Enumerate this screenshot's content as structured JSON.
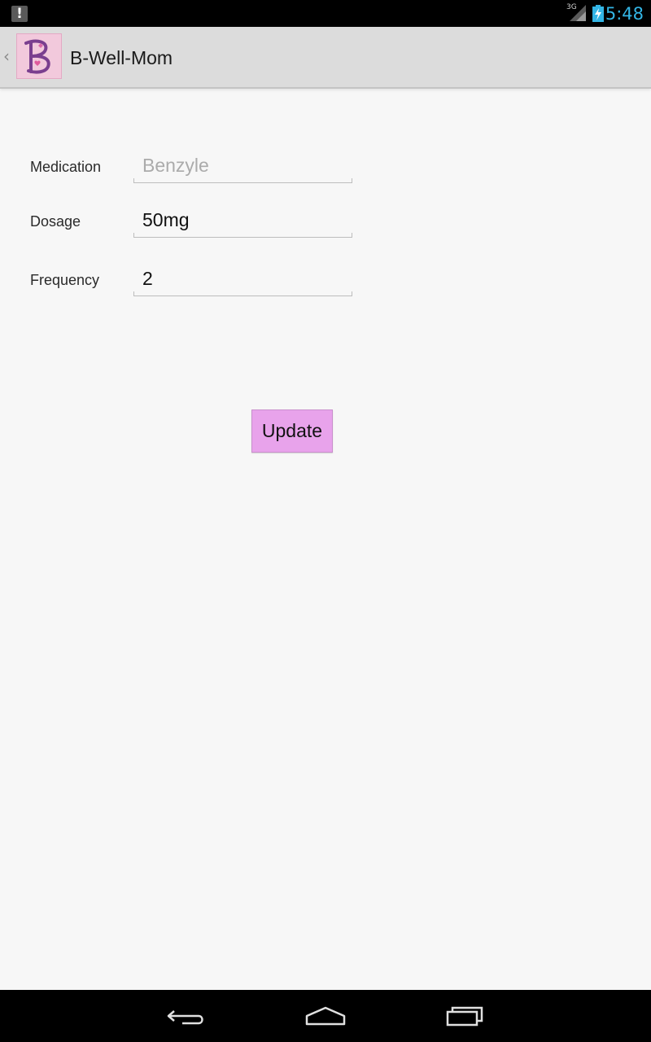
{
  "status_bar": {
    "time": "5:48",
    "network_label": "3G",
    "notification_icon": "alert-icon",
    "signal_icon": "signal-icon",
    "battery_icon": "battery-charging-icon",
    "time_color": "#33b5e5"
  },
  "action_bar": {
    "title": "B-Well-Mom",
    "logo_letter": "B",
    "up_icon": "chevron-left-icon"
  },
  "form": {
    "medication": {
      "label": "Medication",
      "value": "",
      "placeholder": "Benzyle"
    },
    "dosage": {
      "label": "Dosage",
      "value": "50mg",
      "placeholder": ""
    },
    "frequency": {
      "label": "Frequency",
      "value": "2",
      "placeholder": ""
    }
  },
  "update_button": {
    "label": "Update",
    "color": "#e8a3eb"
  },
  "nav_bar": {
    "back_icon": "back-icon",
    "home_icon": "home-icon",
    "recents_icon": "recent-apps-icon"
  }
}
